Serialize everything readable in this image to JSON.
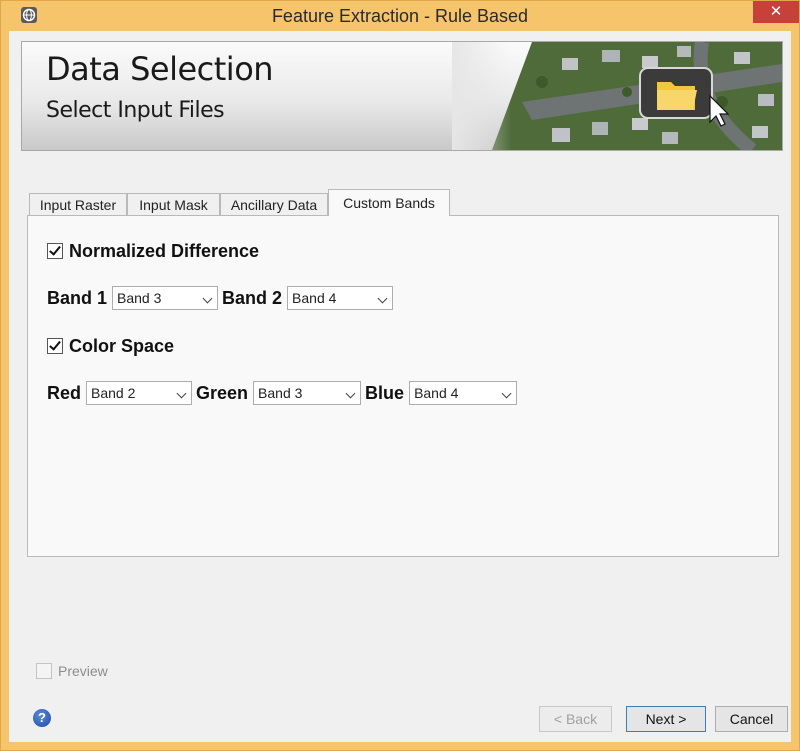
{
  "window": {
    "title": "Feature Extraction - Rule Based",
    "close_glyph": "✕"
  },
  "banner": {
    "title": "Data Selection",
    "subtitle": "Select Input Files"
  },
  "tabs": [
    {
      "label": "Input Raster",
      "active": false
    },
    {
      "label": "Input Mask",
      "active": false
    },
    {
      "label": "Ancillary Data",
      "active": false
    },
    {
      "label": "Custom Bands",
      "active": true
    }
  ],
  "custom_bands": {
    "normalized_difference": {
      "label": "Normalized Difference",
      "checked": true,
      "band1_label": "Band 1",
      "band1_value": "Band 3",
      "band2_label": "Band 2",
      "band2_value": "Band 4"
    },
    "color_space": {
      "label": "Color Space",
      "checked": true,
      "red_label": "Red",
      "red_value": "Band 2",
      "green_label": "Green",
      "green_value": "Band 3",
      "blue_label": "Blue",
      "blue_value": "Band 4"
    }
  },
  "footer": {
    "preview_label": "Preview",
    "preview_checked": false,
    "help_glyph": "?",
    "back_label": "< Back",
    "next_label": "Next >",
    "cancel_label": "Cancel"
  },
  "icons": {
    "app": "globe-app-icon",
    "close": "close-icon",
    "help": "help-icon",
    "folder": "folder-icon",
    "cursor": "cursor-icon",
    "dropdown": "chevron-down-icon"
  },
  "colors": {
    "frame": "#f5c46b",
    "close_button": "#c8403a",
    "help_blue": "#1b4aa8"
  }
}
